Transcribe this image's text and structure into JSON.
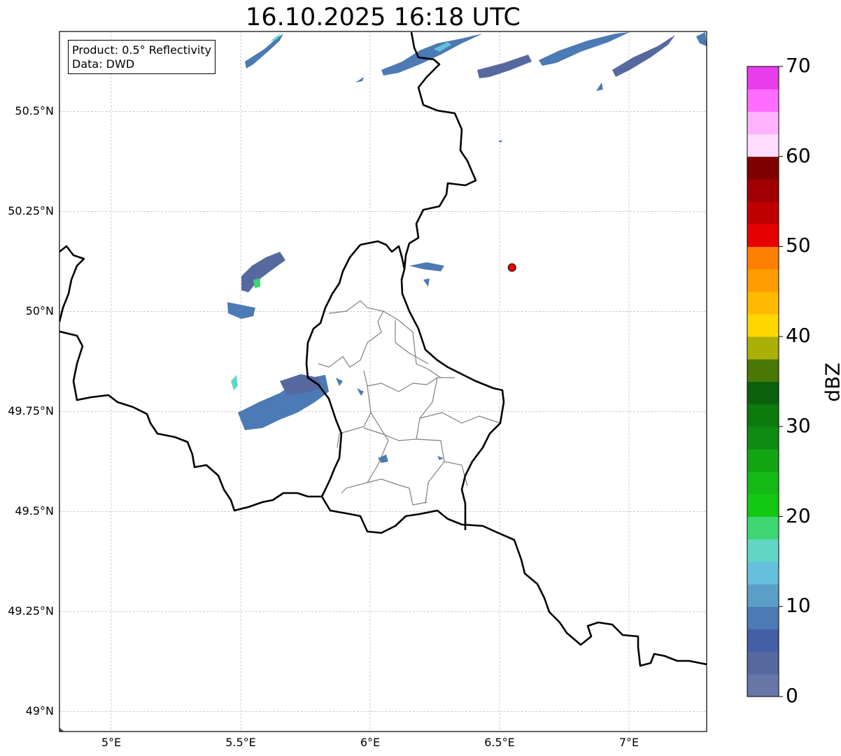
{
  "title": "16.10.2025 16:18 UTC",
  "info": {
    "product_line": "Product: 0.5° Reflectivity",
    "data_line": "Data: DWD"
  },
  "lat_axis": {
    "labels": [
      "50.5°N",
      "50.25°N",
      "50°N",
      "49.75°N",
      "49.5°N",
      "49.25°N",
      "49°N"
    ],
    "values": [
      50.5,
      50.25,
      50.0,
      49.75,
      49.5,
      49.25,
      49.0
    ],
    "range": [
      48.95,
      50.7
    ]
  },
  "lon_axis": {
    "labels": [
      "5°E",
      "5.5°E",
      "6°E",
      "6.5°E",
      "7°E"
    ],
    "values": [
      5.0,
      5.5,
      6.0,
      6.5,
      7.0
    ],
    "range": [
      4.8,
      7.3
    ]
  },
  "marker": {
    "name": "radar-site-marker",
    "lon": 6.548,
    "lat": 50.11,
    "color": "#ee0000"
  },
  "colorbar": {
    "unit": "dBZ",
    "ticks": [
      "0",
      "10",
      "20",
      "30",
      "40",
      "50",
      "60",
      "70"
    ],
    "colors": [
      "#6677a8",
      "#56699f",
      "#445ea5",
      "#4b7ab4",
      "#5b9fc8",
      "#66bfdc",
      "#62d6c6",
      "#3dd673",
      "#13c812",
      "#14b915",
      "#13a414",
      "#0f8a11",
      "#0c7a0f",
      "#0a600b",
      "#4a7806",
      "#aab006",
      "#ffd700",
      "#ffb900",
      "#ff9c00",
      "#ff7f00",
      "#e50000",
      "#c00000",
      "#a00000",
      "#800000",
      "#ffdcff",
      "#ffb3ff",
      "#ff6cff",
      "#e93ced"
    ]
  },
  "colors": {
    "border_country": "#000000",
    "border_admin": "#808080",
    "grid": "#b0b0b0"
  }
}
